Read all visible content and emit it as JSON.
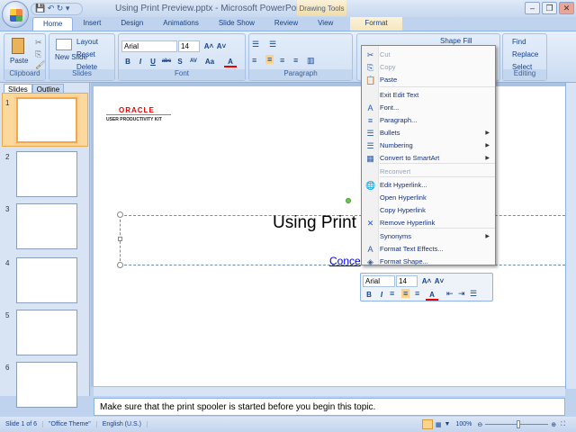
{
  "window": {
    "title": "Using Print Preview.pptx - Microsoft PowerPoint",
    "contextual_tab_group": "Drawing Tools",
    "minimize": "–",
    "restore": "❐",
    "close": "✕"
  },
  "qat": {
    "save": "💾",
    "undo": "↶",
    "redo": "↻",
    "customize": "▾"
  },
  "tabs": [
    "Home",
    "Insert",
    "Design",
    "Animations",
    "Slide Show",
    "Review",
    "View",
    "Format"
  ],
  "ribbon": {
    "clipboard": {
      "label": "Clipboard",
      "paste": "Paste"
    },
    "slides": {
      "label": "Slides",
      "new_slide": "New Slide",
      "layout": "Layout",
      "reset": "Reset",
      "delete": "Delete"
    },
    "font": {
      "label": "Font",
      "font_name": "Arial",
      "font_size": "14",
      "bold": "B",
      "italic": "I",
      "underline": "U",
      "strike": "abc",
      "shadow": "S",
      "spacing": "AV",
      "case": "Aa",
      "color": "A",
      "grow": "A˄",
      "shrink": "A˅"
    },
    "paragraph": {
      "label": "Paragraph"
    },
    "drawing": {
      "shape_fill": "Shape Fill"
    },
    "editing": {
      "label": "Editing",
      "find": "Find",
      "replace": "Replace",
      "select": "Select"
    }
  },
  "left_panel": {
    "tabs": [
      "Slides",
      "Outline"
    ],
    "thumbnails": [
      "1",
      "2",
      "3",
      "4",
      "5",
      "6"
    ]
  },
  "slide": {
    "logo": "ORACLE",
    "logo_sub": "USER PRODUCTIVITY KIT",
    "title": "Using Print",
    "link": "Conce"
  },
  "context_menu": {
    "items": [
      {
        "label": "Cut",
        "icon": "✂",
        "disabled": true
      },
      {
        "label": "Copy",
        "icon": "⎘",
        "disabled": true
      },
      {
        "label": "Paste",
        "icon": "📋"
      },
      {
        "label": "Exit Edit Text",
        "icon": ""
      },
      {
        "label": "Font...",
        "icon": "A"
      },
      {
        "label": "Paragraph...",
        "icon": "≡"
      },
      {
        "label": "Bullets",
        "icon": "☰",
        "submenu": true
      },
      {
        "label": "Numbering",
        "icon": "☰",
        "submenu": true
      },
      {
        "label": "Convert to SmartArt",
        "icon": "▦",
        "submenu": true
      },
      {
        "label": "Reconvert",
        "icon": "",
        "disabled": true
      },
      {
        "label": "Edit Hyperlink...",
        "icon": "🌐"
      },
      {
        "label": "Open Hyperlink",
        "icon": ""
      },
      {
        "label": "Copy Hyperlink",
        "icon": ""
      },
      {
        "label": "Remove Hyperlink",
        "icon": "✕"
      },
      {
        "label": "Synonyms",
        "icon": "",
        "submenu": true
      },
      {
        "label": "Format Text Effects...",
        "icon": "A"
      },
      {
        "label": "Format Shape...",
        "icon": "◈"
      }
    ]
  },
  "mini_toolbar": {
    "font": "Arial",
    "size": "14"
  },
  "notes": {
    "text": "Make sure that the print spooler is started before you begin this topic."
  },
  "status": {
    "slide": "Slide 1 of 6",
    "theme": "\"Office Theme\"",
    "language": "English (U.S.)",
    "zoom": "100%",
    "zoom_level": 100
  }
}
